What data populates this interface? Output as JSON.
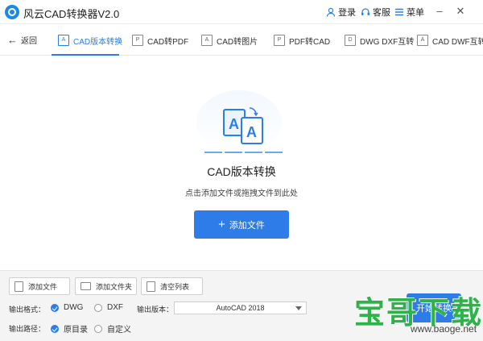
{
  "app": {
    "title": "风云CAD转换器V2.0"
  },
  "header": {
    "login": "登录",
    "service": "客服",
    "menu": "菜单"
  },
  "nav": {
    "back": "返回",
    "tabs": [
      {
        "label": "CAD版本转换",
        "icon": "A"
      },
      {
        "label": "CAD转PDF",
        "icon": "P"
      },
      {
        "label": "CAD转图片",
        "icon": "A"
      },
      {
        "label": "PDF转CAD",
        "icon": "P"
      },
      {
        "label": "DWG DXF互转",
        "icon": "D"
      },
      {
        "label": "CAD DWF互转",
        "icon": "A"
      }
    ]
  },
  "main": {
    "title": "CAD版本转换",
    "subtitle": "点击添加文件或拖拽文件到此处",
    "add_file": "添加文件",
    "icon_letter_a": "A",
    "icon_letter_b": "A"
  },
  "bottom": {
    "add_file": "添加文件",
    "add_folder": "添加文件夹",
    "clear_list": "清空列表",
    "output_format_label": "输出格式：",
    "format_options": [
      "DWG",
      "DXF"
    ],
    "selected_format": "DWG",
    "output_version_label": "输出版本：",
    "version_value": "AutoCAD 2018",
    "output_path_label": "输出路径：",
    "path_options": [
      "原目录",
      "自定义"
    ],
    "selected_path": "原目录",
    "start": "开始转换"
  },
  "watermark": {
    "text": "宝哥下载",
    "url": "www.baoge.net"
  },
  "colors": {
    "accent": "#2b7de9",
    "button": "#2e7ce8",
    "watermark": "#2eb34a"
  }
}
